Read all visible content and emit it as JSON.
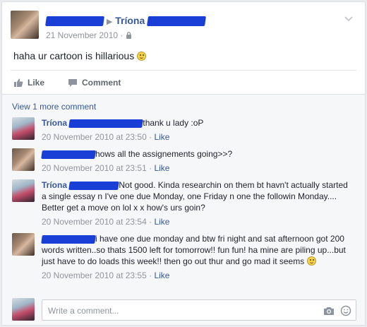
{
  "post": {
    "author": "Tríona",
    "date": "21 November 2010",
    "text": "haha ur cartoon is hillarious",
    "like_label": "Like",
    "comment_label": "Comment"
  },
  "comments_section": {
    "view_more": "View 1 more comment",
    "items": [
      {
        "author": "Tríona",
        "text": "thank u lady :oP",
        "time": "20 November 2010 at 23:50",
        "like": "Like"
      },
      {
        "author": "",
        "text": "hows all the assignements going>>?",
        "time": "20 November 2010 at 23:51",
        "like": "Like"
      },
      {
        "author": "Tríona",
        "text": "Not good. Kinda researchin on them bt havn't actually started a single essay n I've one due Monday, one Friday n one the followin Monday.... Better get a move on lol x x how's urs goin?",
        "time": "20 November 2010 at 23:54",
        "like": "Like"
      },
      {
        "author": "",
        "text": "i have one due monday and btw fri night and sat afternoon got 200 words written..so thats 1500 left for tomorrow!! fun fun! ha mine are piling up...but just have to do loads this week!! then go out thur and go mad it seems",
        "time": "20 November 2010 at 23:55",
        "like": "Like"
      }
    ],
    "write_placeholder": "Write a comment..."
  },
  "colors": {
    "link": "#365899",
    "redaction": "#1a3fd6",
    "meta": "#90949c"
  },
  "icons": [
    "arrow-right-icon",
    "lock-icon",
    "chevron-down-icon",
    "like-icon",
    "comment-icon",
    "smiley-emoji-icon",
    "camera-icon",
    "emoji-icon"
  ]
}
